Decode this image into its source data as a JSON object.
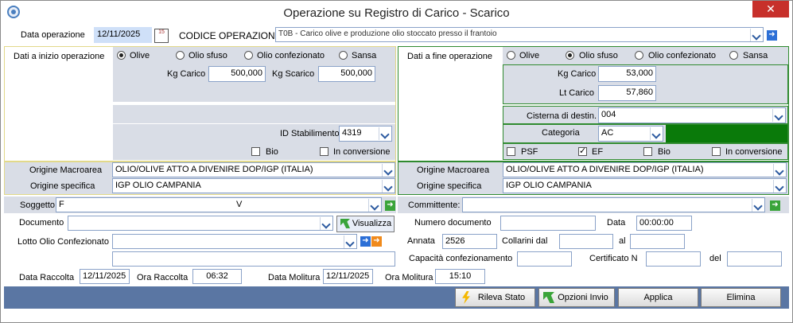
{
  "window": {
    "title": "Operazione su Registro di Carico - Scarico",
    "close_glyph": "✕"
  },
  "header": {
    "data_operazione_label": "Data operazione",
    "data_operazione_value": "12/11/2025",
    "calendar_icon_text": "15",
    "codice_operazione_label": "CODICE OPERAZIONE:",
    "codice_operazione_value": "T0B - Carico olive e produzione olio stoccato presso il frantoio"
  },
  "inizio": {
    "label": "Dati a inizio operazione",
    "radios": [
      {
        "label": "Olive",
        "checked": true
      },
      {
        "label": "Olio sfuso",
        "checked": false
      },
      {
        "label": "Olio confezionato",
        "checked": false
      },
      {
        "label": "Sansa",
        "checked": false
      }
    ],
    "kg_carico_label": "Kg Carico",
    "kg_carico_value": "500,000",
    "kg_scarico_label": "Kg Scarico",
    "kg_scarico_value": "500,000",
    "id_stabilimento_label": "ID Stabilimento",
    "id_stabilimento_value": "4319",
    "bio_label": "Bio",
    "in_conversione_label": "In conversione"
  },
  "fine": {
    "label": "Dati a fine operazione",
    "radios": [
      {
        "label": "Olive",
        "checked": false
      },
      {
        "label": "Olio sfuso",
        "checked": true
      },
      {
        "label": "Olio confezionato",
        "checked": false
      },
      {
        "label": "Sansa",
        "checked": false
      }
    ],
    "kg_carico_label": "Kg Carico",
    "kg_carico_value": "53,000",
    "lt_carico_label": "Lt Carico",
    "lt_carico_value": "57,860",
    "cisterna_label": "Cisterna di destin.",
    "cisterna_value": "004",
    "categoria_label": "Categoria",
    "categoria_value": "AC",
    "psf_label": "PSF",
    "ef_label": "EF",
    "ef_checked_glyph": "✓",
    "bio_label": "Bio",
    "in_conversione_label": "In conversione"
  },
  "origine_left": {
    "macroarea_label": "Origine Macroarea",
    "macroarea_value": "OLIO/OLIVE ATTO A DIVENIRE DOP/IGP (ITALIA)",
    "specifica_label": "Origine specifica",
    "specifica_value": "IGP OLIO CAMPANIA"
  },
  "origine_right": {
    "macroarea_label": "Origine Macroarea",
    "macroarea_value": "OLIO/OLIVE ATTO A DIVENIRE DOP/IGP (ITALIA)",
    "specifica_label": "Origine specifica",
    "specifica_value": "IGP OLIO CAMPANIA"
  },
  "soggetto": {
    "label": "Soggetto:",
    "code": "F",
    "name": "V"
  },
  "committente": {
    "label": "Committente:"
  },
  "documento": {
    "label": "Documento",
    "visualizza_label": "Visualizza"
  },
  "lotto": {
    "label": "Lotto Olio Confezionato"
  },
  "right_fields": {
    "numero_documento_label": "Numero documento",
    "data_label": "Data",
    "data_value": "00:00:00",
    "annata_label": "Annata",
    "annata_value": "2526",
    "collarini_dal_label": "Collarini dal",
    "al_label": "al",
    "capacita_label": "Capacità confezionamento",
    "certificato_label": "Certificato N",
    "del_label": "del"
  },
  "raccolta": {
    "data_raccolta_label": "Data Raccolta",
    "data_raccolta_value": "12/11/2025",
    "ora_raccolta_label": "Ora Raccolta",
    "ora_raccolta_value": "06:32",
    "data_molitura_label": "Data Molitura",
    "data_molitura_value": "12/11/2025",
    "ora_molitura_label": "Ora Molitura",
    "ora_molitura_value": "15:10"
  },
  "buttons": {
    "rileva_stato": "Rileva Stato",
    "opzioni_invio": "Opzioni Invio",
    "applica": "Applica",
    "elimina": "Elimina"
  },
  "nav_glyphs": {
    "arrow": "➜"
  },
  "colors": {
    "green_bar": "#0a7a0a",
    "bottom_bar": "#5a76a3",
    "panel": "#d9dde6",
    "close": "#c7302b"
  }
}
